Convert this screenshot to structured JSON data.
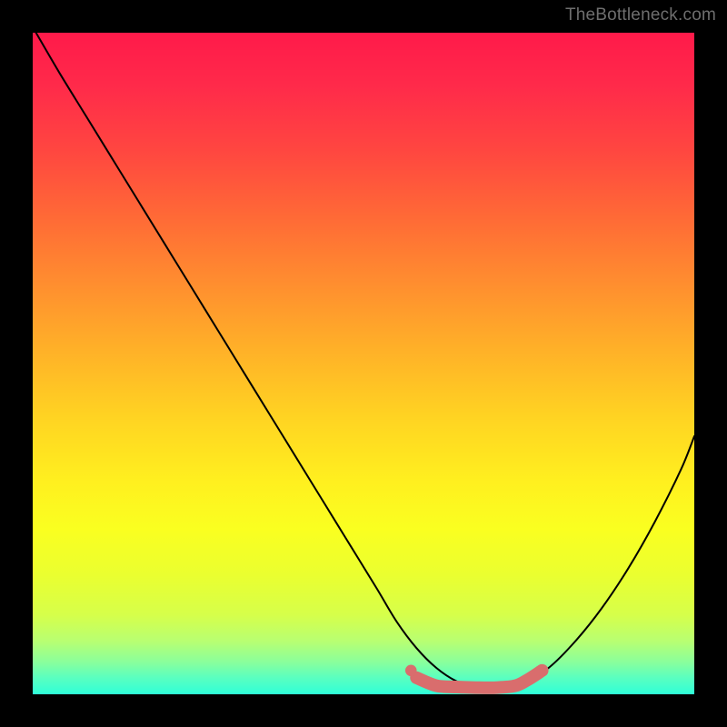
{
  "watermark": "TheBottleneck.com",
  "chart_data": {
    "type": "line",
    "title": "",
    "xlabel": "",
    "ylabel": "",
    "xlim": [
      0,
      100
    ],
    "ylim": [
      0,
      100
    ],
    "grid": false,
    "legend": false,
    "background_gradient": {
      "top_color": "#ff1a4a",
      "bottom_color": "#2fffd8",
      "meaning": "red = high bottleneck, green = low bottleneck"
    },
    "series": [
      {
        "name": "bottleneck-curve",
        "color": "#000000",
        "stroke_width": 2,
        "x": [
          0.5,
          4,
          8,
          12,
          16,
          20,
          24,
          28,
          32,
          36,
          40,
          44,
          48,
          52,
          55,
          58,
          61,
          64,
          67,
          70,
          74,
          78,
          82,
          86,
          90,
          94,
          98,
          100
        ],
        "y": [
          100,
          94,
          87.5,
          81,
          74.5,
          68,
          61.5,
          55,
          48.5,
          42,
          35.5,
          29,
          22.5,
          16,
          11,
          7,
          4,
          2,
          1,
          1,
          1.5,
          4,
          8,
          13,
          19,
          26,
          34,
          39
        ]
      },
      {
        "name": "optimal-zone",
        "color": "#d96d6d",
        "stroke_width": 14,
        "x": [
          58,
          61,
          64,
          67,
          70,
          73,
          75,
          77
        ],
        "y": [
          2.5,
          1.3,
          1.1,
          1.0,
          1.0,
          1.3,
          2.3,
          3.6
        ]
      }
    ],
    "annotations": []
  }
}
